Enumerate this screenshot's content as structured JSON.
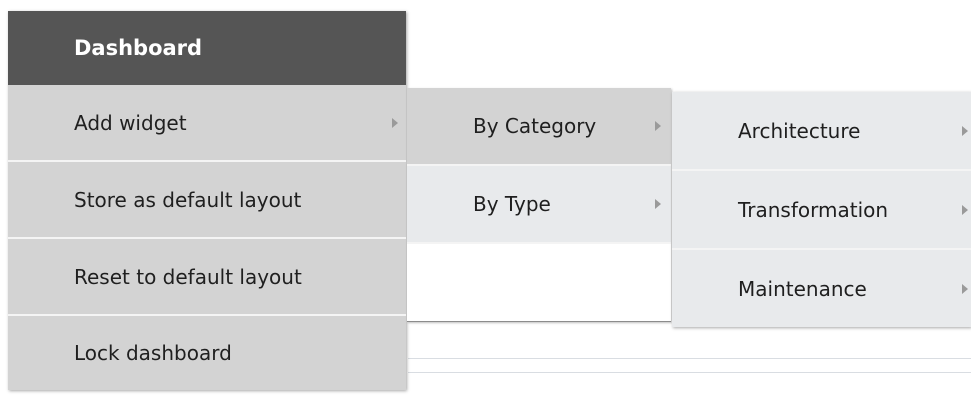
{
  "menu": {
    "header": "Dashboard",
    "items": [
      {
        "label": "Add widget",
        "has_submenu": true
      },
      {
        "label": "Store as default layout",
        "has_submenu": false
      },
      {
        "label": "Reset to default layout",
        "has_submenu": false
      },
      {
        "label": "Lock dashboard",
        "has_submenu": false
      }
    ]
  },
  "submenu_add_widget": {
    "items": [
      {
        "label": "By Category",
        "has_submenu": true,
        "active": true
      },
      {
        "label": "By Type",
        "has_submenu": true,
        "active": false
      }
    ]
  },
  "submenu_by_category": {
    "items": [
      {
        "label": "Architecture",
        "has_submenu": true
      },
      {
        "label": "Transformation",
        "has_submenu": true
      },
      {
        "label": "Maintenance",
        "has_submenu": true
      }
    ]
  },
  "colors": {
    "header_bg": "#555555",
    "item_bg": "#d3d3d3",
    "submenu_bg": "#e8eaec",
    "arrow": "#9a9a9a"
  }
}
